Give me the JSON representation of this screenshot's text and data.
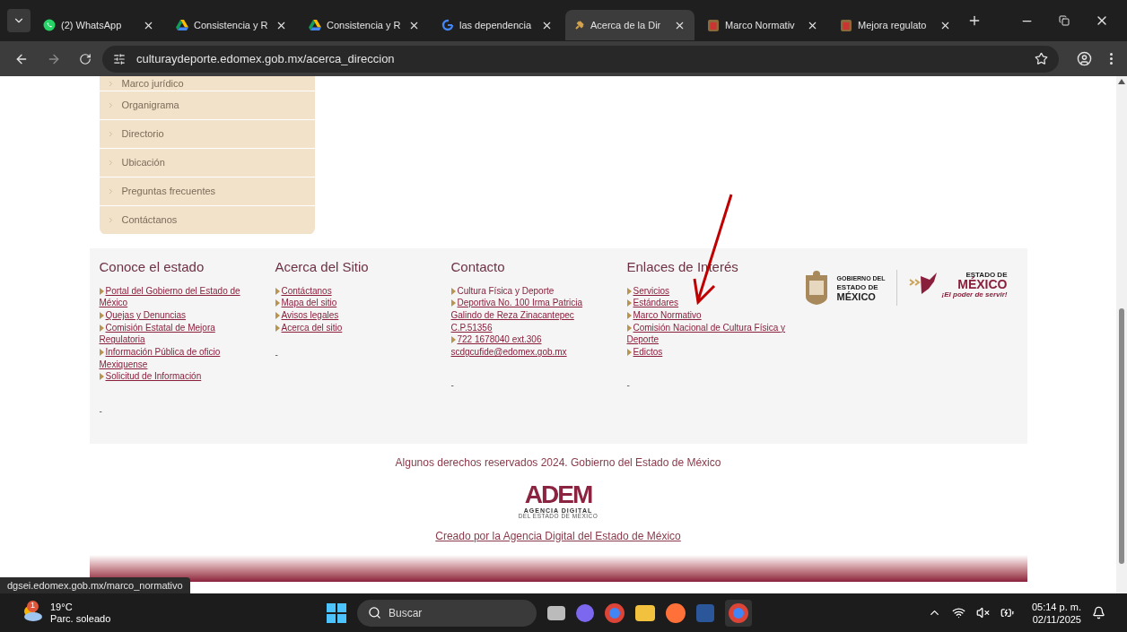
{
  "browser": {
    "tabs": [
      {
        "title": "(2) WhatsApp",
        "kind": "whatsapp",
        "selected": false
      },
      {
        "title": "Consistencia y R",
        "kind": "drive",
        "selected": false
      },
      {
        "title": "Consistencia y R",
        "kind": "drive",
        "selected": false
      },
      {
        "title": "las dependencia",
        "kind": "google",
        "selected": false
      },
      {
        "title": "Acerca de la Dir",
        "kind": "pin",
        "selected": true
      },
      {
        "title": "Marco Normativ",
        "kind": "crest",
        "selected": false
      },
      {
        "title": "Mejora regulato",
        "kind": "crest",
        "selected": false
      }
    ],
    "url": "culturaydeporte.edomex.gob.mx/acerca_direccion"
  },
  "sidebar": {
    "items": [
      {
        "label": "Marco jurídico"
      },
      {
        "label": "Organigrama"
      },
      {
        "label": "Directorio"
      },
      {
        "label": "Ubicación"
      },
      {
        "label": "Preguntas frecuentes"
      },
      {
        "label": "Contáctanos"
      }
    ]
  },
  "footer": {
    "columns": [
      {
        "heading": "Conoce el estado",
        "items": [
          {
            "text": "Portal del Gobierno del Estado de México",
            "link": true,
            "bullet": true
          },
          {
            "text": "Quejas y Denuncias",
            "link": true,
            "bullet": true
          },
          {
            "text": "Comisión Estatal de Mejora Regulatoria",
            "link": true,
            "bullet": true
          },
          {
            "text": "Información Pública de oficio Mexiquense",
            "link": true,
            "bullet": true
          },
          {
            "text": "Solicitud de Información",
            "link": true,
            "bullet": true
          }
        ],
        "dash": "-"
      },
      {
        "heading": "Acerca del Sitio",
        "items": [
          {
            "text": "Contáctanos",
            "link": true,
            "bullet": true
          },
          {
            "text": "Mapa del sitio",
            "link": true,
            "bullet": true
          },
          {
            "text": "Avisos legales",
            "link": true,
            "bullet": true
          },
          {
            "text": "Acerca del sitio",
            "link": true,
            "bullet": true
          }
        ],
        "dash": "-"
      },
      {
        "heading": "Contacto",
        "items": [
          {
            "text": "Cultura Física y Deporte",
            "link": false,
            "bullet": true
          },
          {
            "text": "Deportiva No. 100 Irma Patricia Galindo de Reza Zinacantepec C.P.51356",
            "link": true,
            "bullet": true
          },
          {
            "text": "722 1678040  ext.306",
            "link": true,
            "bullet": true
          },
          {
            "text": "scdgcufide@edomex.gob.mx",
            "link": true,
            "bullet": false
          }
        ],
        "dash": "-"
      },
      {
        "heading": "Enlaces de Interés",
        "items": [
          {
            "text": "Servicios",
            "link": true,
            "bullet": true
          },
          {
            "text": "Estándares",
            "link": true,
            "bullet": true
          },
          {
            "text": "Marco Normativo",
            "link": true,
            "bullet": true
          },
          {
            "text": "Comisión Nacional de Cultura Física y Deporte",
            "link": true,
            "bullet": true
          },
          {
            "text": "Edictos",
            "link": true,
            "bullet": true
          }
        ],
        "dash": "-"
      }
    ],
    "gov_logo": {
      "line1": "GOBIERNO DEL",
      "line2": "ESTADO DE",
      "line3": "MÉXICO"
    },
    "state_logo": {
      "line1": "ESTADO DE",
      "line2": "MÉXICO",
      "slogan": "¡El poder de servir!"
    },
    "copyright": "Algunos derechos reservados 2024. Gobierno del Estado de México",
    "adem_logo": {
      "mark": "ADEM",
      "line1": "AGENCIA DIGITAL",
      "line2": "DEL ESTADO DE MÉXICO"
    },
    "credit_link": "Creado por la Agencia Digital del Estado de México"
  },
  "status_url": "dgsei.edomex.gob.mx/marco_normativo",
  "taskbar": {
    "weather": {
      "badge": "1",
      "temp": "19°C",
      "desc": "Parc. soleado"
    },
    "search": {
      "placeholder": "Buscar"
    },
    "time": "05:14 p. m.",
    "date": "02/11/2025"
  }
}
